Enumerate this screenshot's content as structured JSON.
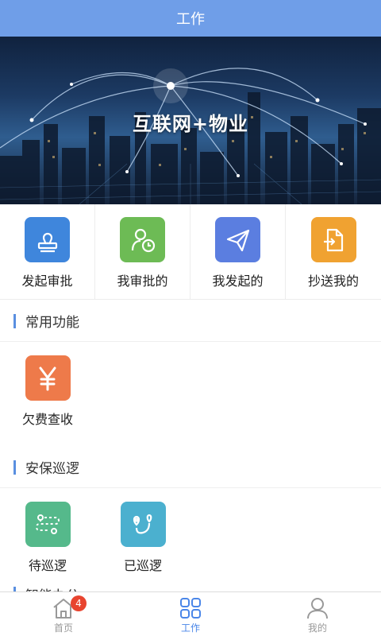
{
  "header": {
    "title": "工作"
  },
  "banner": {
    "title": "互联网+物业"
  },
  "quick_actions": [
    {
      "label": "发起审批",
      "icon": "stamp-icon",
      "color": "#3f86dc"
    },
    {
      "label": "我审批的",
      "icon": "user-clock-icon",
      "color": "#6dbb55"
    },
    {
      "label": "我发起的",
      "icon": "paper-plane-icon",
      "color": "#5b7ee0"
    },
    {
      "label": "抄送我的",
      "icon": "document-export-icon",
      "color": "#f0a231"
    }
  ],
  "sections": {
    "common": {
      "title": "常用功能",
      "items": [
        {
          "label": "欠费查收",
          "icon": "yen-icon",
          "color": "#ee7a4a"
        }
      ]
    },
    "patrol": {
      "title": "安保巡逻",
      "items": [
        {
          "label": "待巡逻",
          "icon": "route-pending-icon",
          "color": "#55b98b"
        },
        {
          "label": "已巡逻",
          "icon": "route-done-icon",
          "color": "#4bb0cf"
        }
      ]
    },
    "office": {
      "title": "智能办公"
    }
  },
  "tabbar": {
    "items": [
      {
        "label": "首页",
        "icon": "home-icon",
        "badge": "4"
      },
      {
        "label": "工作",
        "icon": "grid-icon",
        "active": true
      },
      {
        "label": "我的",
        "icon": "user-icon"
      }
    ],
    "active_color": "#4a86e8",
    "inactive_color": "#999999"
  }
}
